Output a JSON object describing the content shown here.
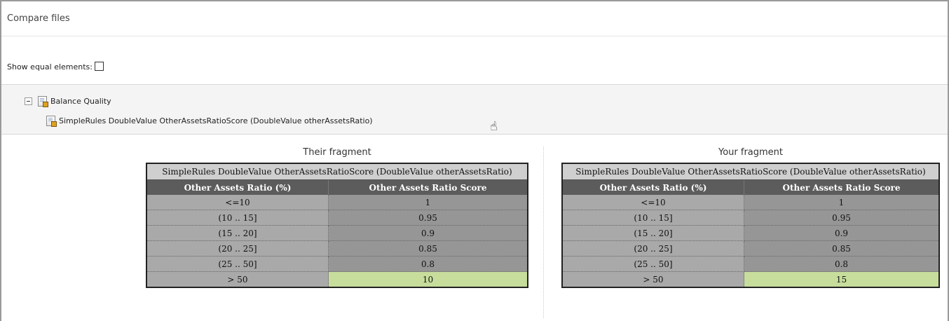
{
  "header": {
    "title": "Compare files"
  },
  "options": {
    "show_equal_label": "Show equal elements:",
    "show_equal_checked": false
  },
  "tree": {
    "root_label": "Balance Quality",
    "child_label": "SimpleRules DoubleValue OtherAssetsRatioScore (DoubleValue otherAssetsRatio)"
  },
  "fragments": {
    "their": {
      "title": "Their fragment",
      "table_caption": "SimpleRules DoubleValue OtherAssetsRatioScore (DoubleValue otherAssetsRatio)",
      "columns": [
        "Other Assets Ratio (%)",
        "Other Assets Ratio Score"
      ],
      "rows": [
        [
          "<=10",
          "1"
        ],
        [
          "(10 .. 15]",
          "0.95"
        ],
        [
          "(15 .. 20]",
          "0.9"
        ],
        [
          "(20 .. 25]",
          "0.85"
        ],
        [
          "(25 .. 50]",
          "0.8"
        ],
        [
          "> 50",
          "10"
        ]
      ]
    },
    "your": {
      "title": "Your fragment",
      "table_caption": "SimpleRules DoubleValue OtherAssetsRatioScore (DoubleValue otherAssetsRatio)",
      "columns": [
        "Other Assets Ratio (%)",
        "Other Assets Ratio Score"
      ],
      "rows": [
        [
          "<=10",
          "1"
        ],
        [
          "(10 .. 15]",
          "0.95"
        ],
        [
          "(15 .. 20]",
          "0.9"
        ],
        [
          "(20 .. 25]",
          "0.85"
        ],
        [
          "(25 .. 50]",
          "0.8"
        ],
        [
          "> 50",
          "15"
        ]
      ]
    }
  },
  "colors": {
    "changed_highlight": "#c7dd9c",
    "header_bg": "#5c5c5c",
    "condition_bg": "#a9a9a9",
    "score_bg": "#969696"
  },
  "icons": {
    "collapse": "minus-box-icon",
    "tree_node": "rules-document-icon",
    "cursor": "hand-pointer-icon"
  }
}
